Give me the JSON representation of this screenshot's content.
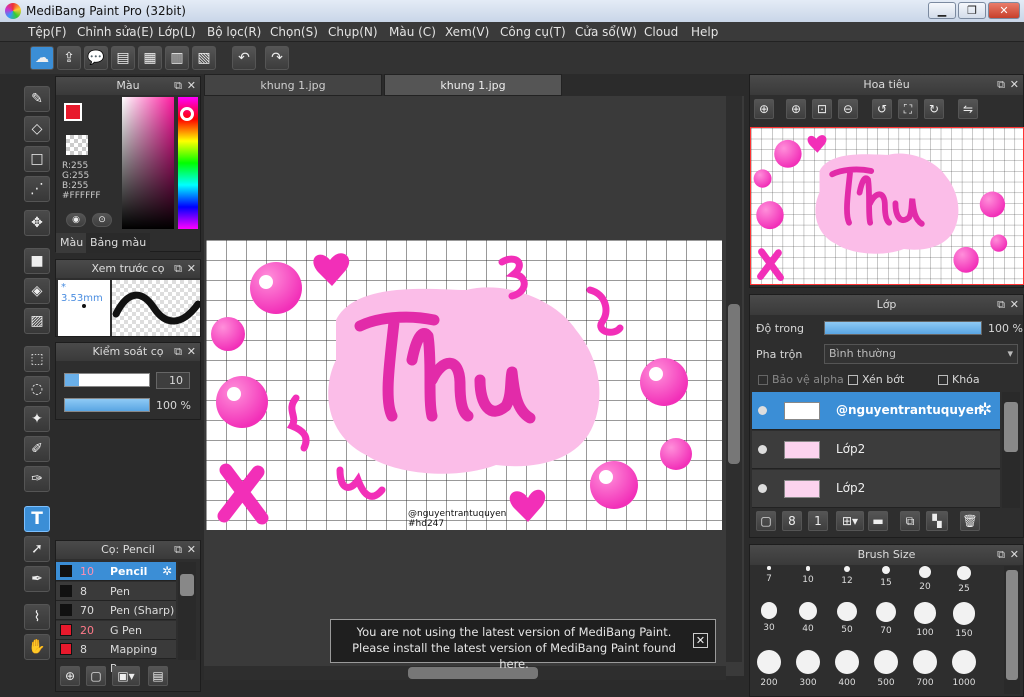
{
  "window": {
    "title": "MediBang Paint Pro (32bit)"
  },
  "menu": [
    "Tệp(F)",
    "Chỉnh sửa(E)",
    "Lớp(L)",
    "Bộ lọc(R)",
    "Chọn(S)",
    "Chụp(N)",
    "Màu (C)",
    "Xem(V)",
    "Công cụ(T)",
    "Cửa sổ(W)",
    "Cloud",
    "Help"
  ],
  "color_panel": {
    "title": "Màu",
    "r": "R:255",
    "g": "G:255",
    "b": "B:255",
    "hex": "#FFFFFF",
    "tab_color": "Màu",
    "tab_palette": "Bảng màu",
    "primary_color": "#e8192c",
    "secondary_color": "#9b6fd6"
  },
  "preview_panel": {
    "title": "Xem trước cọ",
    "size": "3.53mm"
  },
  "control_panel": {
    "title": "Kiểm soát cọ",
    "size_value": "10",
    "opacity_value": "100 %"
  },
  "brush_panel": {
    "title": "Cọ: Pencil",
    "items": [
      {
        "size": "10",
        "name": "Pencil",
        "color": "#111111"
      },
      {
        "size": "8",
        "name": "Pen",
        "color": "#111111"
      },
      {
        "size": "70",
        "name": "Pen (Sharp)",
        "color": "#111111"
      },
      {
        "size": "20",
        "name": "G Pen",
        "color": "#e8192c"
      },
      {
        "size": "8",
        "name": "Mapping Pen",
        "color": "#e8192c"
      }
    ]
  },
  "doc_tabs": [
    "khung 1.jpg",
    "khung 1.jpg"
  ],
  "artwork": {
    "text": "Thu",
    "signature": "@nguyentrantuquyen",
    "tag": "#hd247"
  },
  "notification": {
    "line1": "You are not using the latest version of MediBang Paint.",
    "line2": "Please install the latest version of MediBang Paint found here."
  },
  "navigator_panel": {
    "title": "Hoa tiêu"
  },
  "layer_panel": {
    "title": "Lớp",
    "opacity_label": "Độ trong",
    "opacity_value": "100 %",
    "opacity_fraction": 1.0,
    "blend_label": "Pha trộn",
    "blend_value": "Bình thường",
    "protect_alpha": "Bảo vệ alpha",
    "clipping": "Xén bớt",
    "lock": "Khóa",
    "layers": [
      {
        "name": "@nguyentrantuquyen",
        "selected": true
      },
      {
        "name": "Lớp2",
        "selected": false
      },
      {
        "name": "Lớp2",
        "selected": false
      }
    ]
  },
  "brush_size_panel": {
    "title": "Brush Size",
    "row1": [
      "7",
      "10",
      "12",
      "15",
      "20",
      "25"
    ],
    "row2": [
      "30",
      "40",
      "50",
      "70",
      "100",
      "150"
    ],
    "row3": [
      "200",
      "300",
      "400",
      "500",
      "700",
      "1000"
    ]
  }
}
